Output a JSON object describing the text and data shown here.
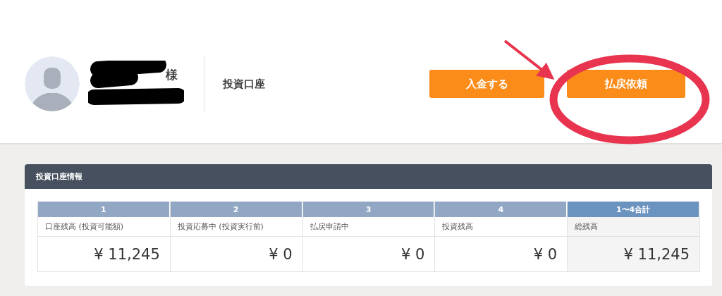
{
  "profile": {
    "honorific": "様",
    "account_label": "投資口座"
  },
  "buttons": [
    {
      "label": "入金する"
    },
    {
      "label": "払戻依頼"
    }
  ],
  "panel": {
    "title": "投資口座情報",
    "columns": [
      {
        "header": "1",
        "label": "口座残高 (投資可能額)",
        "value": "¥ 11,245",
        "kind": "item"
      },
      {
        "header": "2",
        "label": "投資応募中 (投資実行前)",
        "value": "¥ 0",
        "kind": "item"
      },
      {
        "header": "3",
        "label": "払戻申請中",
        "value": "¥ 0",
        "kind": "item"
      },
      {
        "header": "4",
        "label": "投資残高",
        "value": "¥ 0",
        "kind": "item"
      },
      {
        "header": "1〜4合計",
        "label": "総残高",
        "value": "¥ 11,245",
        "kind": "total"
      }
    ]
  }
}
